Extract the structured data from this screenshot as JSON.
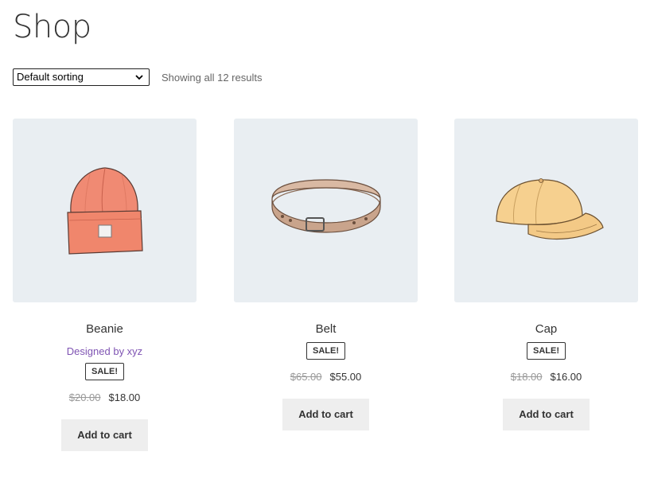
{
  "page": {
    "title": "Shop"
  },
  "toolbar": {
    "sort_selected": "Default sorting",
    "result_count": "Showing all 12 results"
  },
  "products": [
    {
      "name": "Beanie",
      "designer": "Designed by xyz",
      "sale_badge": "SALE!",
      "regular_price": "$20.00",
      "sale_price": "$18.00",
      "button": "Add to cart",
      "image_icon": "beanie-image"
    },
    {
      "name": "Belt",
      "sale_badge": "SALE!",
      "regular_price": "$65.00",
      "sale_price": "$55.00",
      "button": "Add to cart",
      "image_icon": "belt-image"
    },
    {
      "name": "Cap",
      "sale_badge": "SALE!",
      "regular_price": "$18.00",
      "sale_price": "$16.00",
      "button": "Add to cart",
      "image_icon": "cap-image"
    }
  ],
  "colors": {
    "thumb_bg": "#e9eef2",
    "designer_link": "#7f54b3",
    "button_bg": "#eeeeee"
  }
}
